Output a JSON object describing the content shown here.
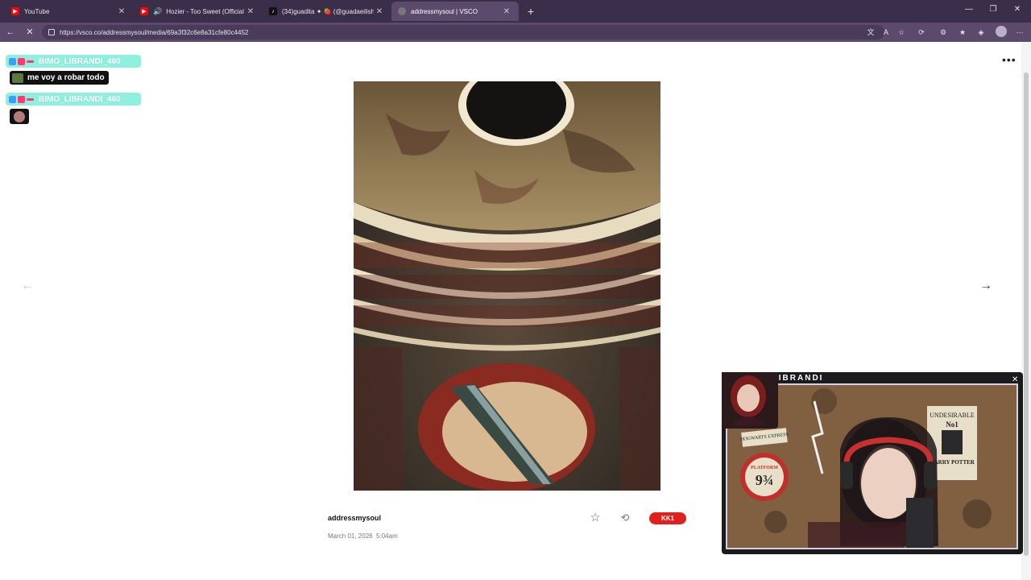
{
  "browser": {
    "tabs": [
      {
        "label": "YouTube",
        "color": "#ff0000",
        "active": false
      },
      {
        "label": "Hozier - Too Sweet (Official V",
        "color": "#ff0000",
        "active": false
      },
      {
        "label": "(34)guadita ✦ 🍓 (@guadaeilish) |",
        "color": "#111111",
        "active": false
      },
      {
        "label": "addressmysoul | VSCO",
        "color": "#444444",
        "active": true
      }
    ],
    "url": "https://vsco.co/addressmysoul/media/69a3f32c6e8a31cfe80c4452"
  },
  "post": {
    "username": "addressmysoul",
    "date": "March 01, 2026",
    "time": "5:04am",
    "preset": "KK1"
  },
  "chat": {
    "username": "BIMO_LIBRANDI_460",
    "message": "me voy a robar todo"
  },
  "stream": {
    "title": "GUADALIBRANDI",
    "sign_line1": "UNDESIRABLE",
    "sign_line2": "No1",
    "sign_line3": "HARRY POTTER",
    "sign_hogwarts": "HOGWARTS EXPRESS",
    "platform": "PLATFORM",
    "platform_num": "9¾"
  },
  "icons": {
    "back": "back-arrow-icon",
    "reload": "reload-icon",
    "star": "star-icon",
    "repost": "repost-icon",
    "more": "more-icon",
    "prev": "chevron-left-icon",
    "next": "chevron-right-icon"
  }
}
